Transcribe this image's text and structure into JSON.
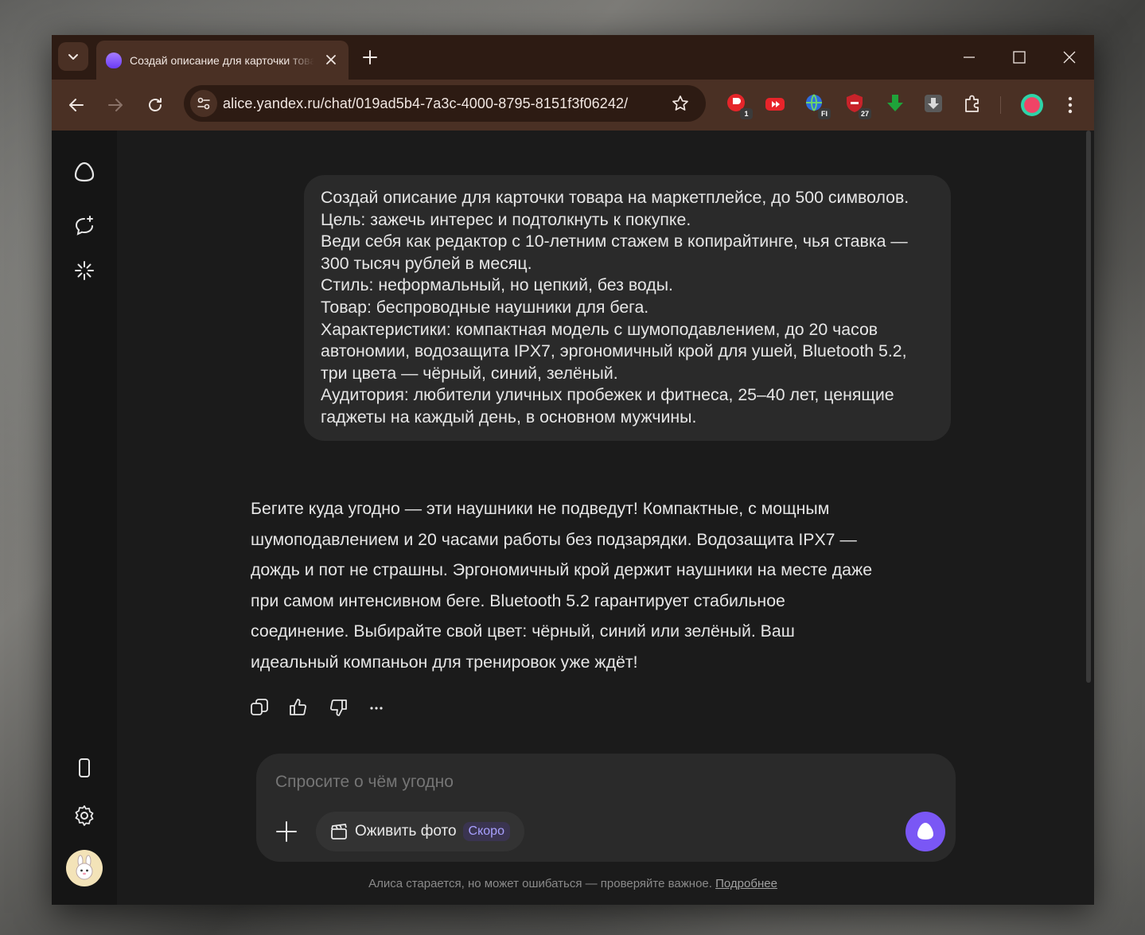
{
  "browser": {
    "tab_title": "Создай описание для карточки товара на маркетплейсе",
    "url": "alice.yandex.ru/chat/019ad5b4-7a3c-4000-8795-8151f3f06242/",
    "extensions": [
      {
        "name": "extension-1-icon",
        "badge": "1"
      },
      {
        "name": "extension-youtube-icon",
        "badge": ""
      },
      {
        "name": "extension-globe-icon",
        "badge": "FI"
      },
      {
        "name": "extension-shield-icon",
        "badge": "27"
      },
      {
        "name": "extension-download-green-icon",
        "badge": ""
      },
      {
        "name": "extension-download-gray-icon",
        "badge": ""
      }
    ]
  },
  "chat": {
    "user_message": [
      "Создай описание для карточки товара на маркетплейсе, до 500 символов.",
      "Цель: зажечь интерес и подтолкнуть к покупке.",
      "Веди себя как редактор с 10-летним стажем в копирайтинге, чья ставка —",
      "300 тысяч рублей в месяц.",
      "Стиль: неформальный, но цепкий, без воды.",
      "Товар: беспроводные наушники для бега.",
      "Характеристики: компактная модель с шумоподавлением, до 20 часов",
      "автономии, водозащита IPX7, эргономичный крой для ушей, Bluetooth 5.2,",
      "три цвета — чёрный, синий, зелёный.",
      "Аудитория: любители уличных пробежек и фитнеса, 25–40 лет, ценящие",
      "гаджеты на каждый день, в основном мужчины."
    ],
    "assistant_message": [
      "Бегите куда угодно — эти наушники не подведут! Компактные, с мощным",
      "шумоподавлением и 20 часами работы без подзарядки. Водозащита IPX7 —",
      "дождь и пот не страшны. Эргономичный крой держит наушники на месте даже",
      "при самом интенсивном беге. Bluetooth 5.2 гарантирует стабильное",
      "соединение. Выбирайте свой цвет: чёрный, синий или зелёный. Ваш",
      "идеальный компаньон для тренировок уже ждёт!"
    ]
  },
  "composer": {
    "placeholder": "Спросите о чём угодно",
    "chip_label": "Оживить фото",
    "chip_badge": "Скоро"
  },
  "footer": {
    "disclaimer": "Алиса старается, но может ошибаться — проверяйте важное.",
    "link": "Подробнее"
  },
  "colors": {
    "tabstrip": "#2d1b13",
    "toolbar": "#4a3024",
    "page_bg": "#1b1b1b",
    "bubble": "#2a2a2a",
    "accent": "#7a57f5"
  }
}
